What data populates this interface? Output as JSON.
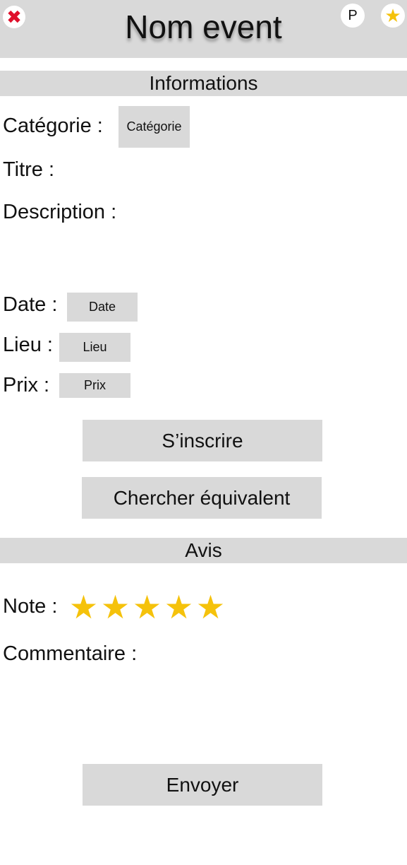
{
  "header": {
    "title": "Nom event",
    "close_icon": "✖",
    "profile_label": "P",
    "favorite_icon": "★"
  },
  "informations": {
    "section_title": "Informations",
    "category_label": "Catégorie :",
    "category_value": "Catégorie",
    "title_label": "Titre :",
    "description_label": "Description :",
    "date_label": "Date :",
    "date_value": "Date",
    "location_label": "Lieu :",
    "location_value": "Lieu",
    "price_label": "Prix :",
    "price_value": "Prix"
  },
  "actions": {
    "register_label": "S’inscrire",
    "find_equivalent_label": "Chercher équivalent"
  },
  "review": {
    "section_title": "Avis",
    "rating_label": "Note :",
    "rating_value": 5,
    "rating_max": 5,
    "star_glyph": "★",
    "comment_label": "Commentaire :",
    "send_label": "Envoyer"
  },
  "colors": {
    "panel_gray": "#d9d9d9",
    "star_yellow": "#f5c20b",
    "close_red": "#e0102b"
  }
}
